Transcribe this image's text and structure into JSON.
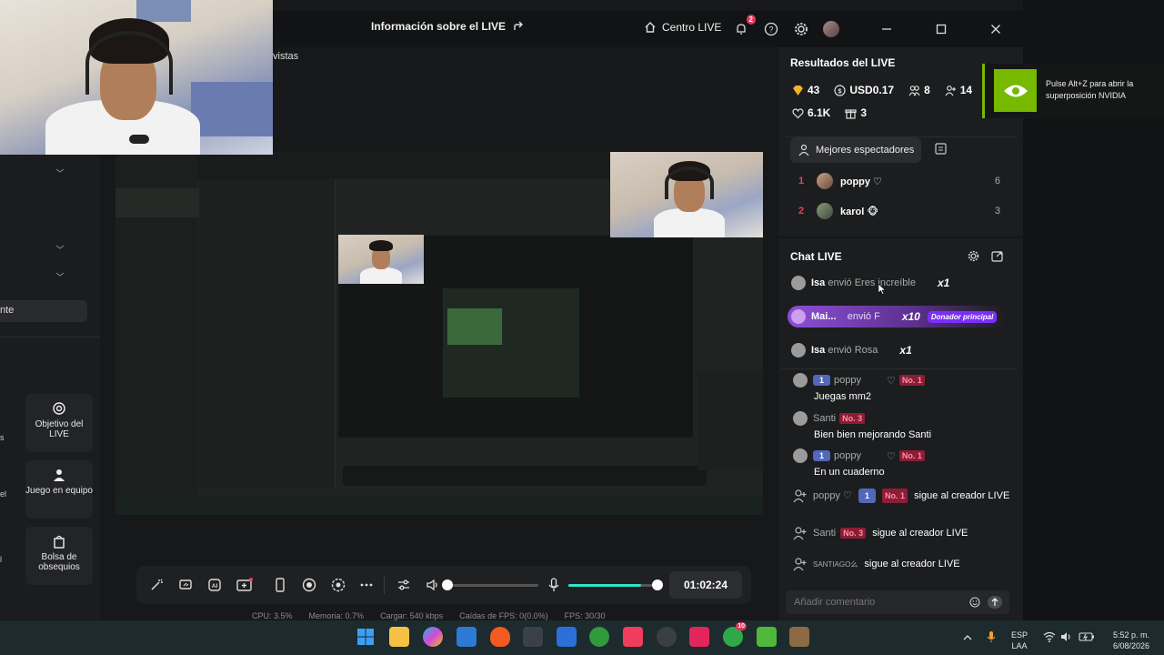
{
  "window": {
    "title": "Información sobre el LIVE",
    "centro_live": "Centro LIVE",
    "notification_count": "2",
    "vistas": "vistas"
  },
  "left_sidebar": {
    "pill_text": "nte",
    "cards": [
      {
        "label": "Objetivo del LIVE",
        "icon": "target-icon"
      },
      {
        "label": "Juego en equipo",
        "icon": "team-icon"
      },
      {
        "label": "Bolsa de obsequios",
        "icon": "gift-bag-icon"
      }
    ],
    "edge_labels": [
      "s",
      "el",
      "l"
    ]
  },
  "live_results": {
    "title": "Resultados del LIVE",
    "stats": {
      "diamonds": "43",
      "usd": "USD0.17",
      "viewers": "8",
      "followers": "14",
      "likes": "6.1K",
      "gifts": "3"
    }
  },
  "top_viewers": {
    "button_label": "Mejores espectadores",
    "list": [
      {
        "rank": "1",
        "name": "poppy ♡",
        "score": "6"
      },
      {
        "rank": "2",
        "name": "karol 🐵",
        "score": "3"
      }
    ]
  },
  "chat": {
    "title": "Chat LIVE",
    "gifts": [
      {
        "user": "Isa",
        "action": "envió Eres increíble",
        "mult": "x1",
        "donor": ""
      },
      {
        "user": "Mai...",
        "action": "envió F",
        "mult": "x10",
        "donor": "Donador principal"
      },
      {
        "user": "Isa",
        "action": "envió Rosa",
        "mult": "x1",
        "donor": ""
      }
    ],
    "messages": [
      {
        "user": "poppy",
        "level": "1",
        "heart": "♡",
        "badge": "No. 1",
        "text": "Juegas mm2"
      },
      {
        "user": "Santi",
        "level": "",
        "heart": "",
        "badge": "No. 3",
        "text": "Bien bien mejorando Santi"
      },
      {
        "user": "poppy",
        "level": "1",
        "heart": "♡",
        "badge": "No. 1",
        "text": "En un cuaderno"
      }
    ],
    "follows": [
      {
        "user": "poppy ♡",
        "level": "1",
        "badge": "No. 1",
        "text": "sigue al creador LIVE"
      },
      {
        "user": "Santi",
        "level": "",
        "badge": "No. 3",
        "text": "sigue al creador LIVE"
      },
      {
        "user": "SANTIAGO么",
        "level": "",
        "badge": "",
        "text": "sigue al creador LIVE"
      }
    ],
    "comment_placeholder": "Añadir comentario"
  },
  "nvidia": {
    "text": "Pulse Alt+Z para abrir la superposición NVIDIA"
  },
  "controls": {
    "timer": "01:02:24",
    "volume_level": 0.0,
    "mic_level": 0.8
  },
  "status": {
    "cpu": "CPU: 3.5%",
    "memory": "Memoria: 0.7%",
    "load": "Cargar: 540 kbps",
    "fps_drops": "Caídas de FPS: 0(0.0%)",
    "fps": "FPS: 30/30"
  },
  "taskbar": {
    "lang1": "ESP",
    "lang2": "LAA",
    "time": "5:52 p. m.",
    "date": "6/08/2026",
    "xbox_badge": "10"
  },
  "colors": {
    "accent_red": "#f03e5e",
    "teal": "#2ee6c9",
    "nvidia_green": "#76b900",
    "donor_purple": "#7b2ff7"
  }
}
